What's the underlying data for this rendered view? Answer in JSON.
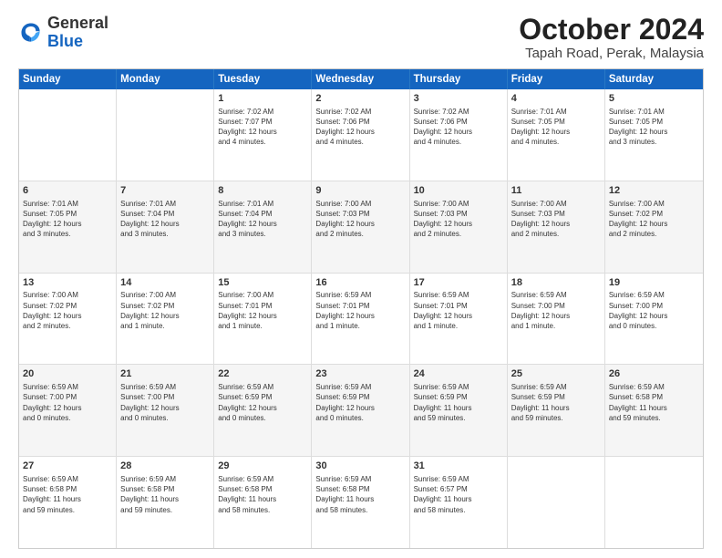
{
  "logo": {
    "general": "General",
    "blue": "Blue"
  },
  "header": {
    "month": "October 2024",
    "location": "Tapah Road, Perak, Malaysia"
  },
  "weekdays": [
    "Sunday",
    "Monday",
    "Tuesday",
    "Wednesday",
    "Thursday",
    "Friday",
    "Saturday"
  ],
  "rows": [
    [
      {
        "day": "",
        "text": ""
      },
      {
        "day": "",
        "text": ""
      },
      {
        "day": "1",
        "text": "Sunrise: 7:02 AM\nSunset: 7:07 PM\nDaylight: 12 hours\nand 4 minutes."
      },
      {
        "day": "2",
        "text": "Sunrise: 7:02 AM\nSunset: 7:06 PM\nDaylight: 12 hours\nand 4 minutes."
      },
      {
        "day": "3",
        "text": "Sunrise: 7:02 AM\nSunset: 7:06 PM\nDaylight: 12 hours\nand 4 minutes."
      },
      {
        "day": "4",
        "text": "Sunrise: 7:01 AM\nSunset: 7:05 PM\nDaylight: 12 hours\nand 4 minutes."
      },
      {
        "day": "5",
        "text": "Sunrise: 7:01 AM\nSunset: 7:05 PM\nDaylight: 12 hours\nand 3 minutes."
      }
    ],
    [
      {
        "day": "6",
        "text": "Sunrise: 7:01 AM\nSunset: 7:05 PM\nDaylight: 12 hours\nand 3 minutes."
      },
      {
        "day": "7",
        "text": "Sunrise: 7:01 AM\nSunset: 7:04 PM\nDaylight: 12 hours\nand 3 minutes."
      },
      {
        "day": "8",
        "text": "Sunrise: 7:01 AM\nSunset: 7:04 PM\nDaylight: 12 hours\nand 3 minutes."
      },
      {
        "day": "9",
        "text": "Sunrise: 7:00 AM\nSunset: 7:03 PM\nDaylight: 12 hours\nand 2 minutes."
      },
      {
        "day": "10",
        "text": "Sunrise: 7:00 AM\nSunset: 7:03 PM\nDaylight: 12 hours\nand 2 minutes."
      },
      {
        "day": "11",
        "text": "Sunrise: 7:00 AM\nSunset: 7:03 PM\nDaylight: 12 hours\nand 2 minutes."
      },
      {
        "day": "12",
        "text": "Sunrise: 7:00 AM\nSunset: 7:02 PM\nDaylight: 12 hours\nand 2 minutes."
      }
    ],
    [
      {
        "day": "13",
        "text": "Sunrise: 7:00 AM\nSunset: 7:02 PM\nDaylight: 12 hours\nand 2 minutes."
      },
      {
        "day": "14",
        "text": "Sunrise: 7:00 AM\nSunset: 7:02 PM\nDaylight: 12 hours\nand 1 minute."
      },
      {
        "day": "15",
        "text": "Sunrise: 7:00 AM\nSunset: 7:01 PM\nDaylight: 12 hours\nand 1 minute."
      },
      {
        "day": "16",
        "text": "Sunrise: 6:59 AM\nSunset: 7:01 PM\nDaylight: 12 hours\nand 1 minute."
      },
      {
        "day": "17",
        "text": "Sunrise: 6:59 AM\nSunset: 7:01 PM\nDaylight: 12 hours\nand 1 minute."
      },
      {
        "day": "18",
        "text": "Sunrise: 6:59 AM\nSunset: 7:00 PM\nDaylight: 12 hours\nand 1 minute."
      },
      {
        "day": "19",
        "text": "Sunrise: 6:59 AM\nSunset: 7:00 PM\nDaylight: 12 hours\nand 0 minutes."
      }
    ],
    [
      {
        "day": "20",
        "text": "Sunrise: 6:59 AM\nSunset: 7:00 PM\nDaylight: 12 hours\nand 0 minutes."
      },
      {
        "day": "21",
        "text": "Sunrise: 6:59 AM\nSunset: 7:00 PM\nDaylight: 12 hours\nand 0 minutes."
      },
      {
        "day": "22",
        "text": "Sunrise: 6:59 AM\nSunset: 6:59 PM\nDaylight: 12 hours\nand 0 minutes."
      },
      {
        "day": "23",
        "text": "Sunrise: 6:59 AM\nSunset: 6:59 PM\nDaylight: 12 hours\nand 0 minutes."
      },
      {
        "day": "24",
        "text": "Sunrise: 6:59 AM\nSunset: 6:59 PM\nDaylight: 11 hours\nand 59 minutes."
      },
      {
        "day": "25",
        "text": "Sunrise: 6:59 AM\nSunset: 6:59 PM\nDaylight: 11 hours\nand 59 minutes."
      },
      {
        "day": "26",
        "text": "Sunrise: 6:59 AM\nSunset: 6:58 PM\nDaylight: 11 hours\nand 59 minutes."
      }
    ],
    [
      {
        "day": "27",
        "text": "Sunrise: 6:59 AM\nSunset: 6:58 PM\nDaylight: 11 hours\nand 59 minutes."
      },
      {
        "day": "28",
        "text": "Sunrise: 6:59 AM\nSunset: 6:58 PM\nDaylight: 11 hours\nand 59 minutes."
      },
      {
        "day": "29",
        "text": "Sunrise: 6:59 AM\nSunset: 6:58 PM\nDaylight: 11 hours\nand 58 minutes."
      },
      {
        "day": "30",
        "text": "Sunrise: 6:59 AM\nSunset: 6:58 PM\nDaylight: 11 hours\nand 58 minutes."
      },
      {
        "day": "31",
        "text": "Sunrise: 6:59 AM\nSunset: 6:57 PM\nDaylight: 11 hours\nand 58 minutes."
      },
      {
        "day": "",
        "text": ""
      },
      {
        "day": "",
        "text": ""
      }
    ]
  ],
  "alt_rows": [
    1,
    3
  ]
}
